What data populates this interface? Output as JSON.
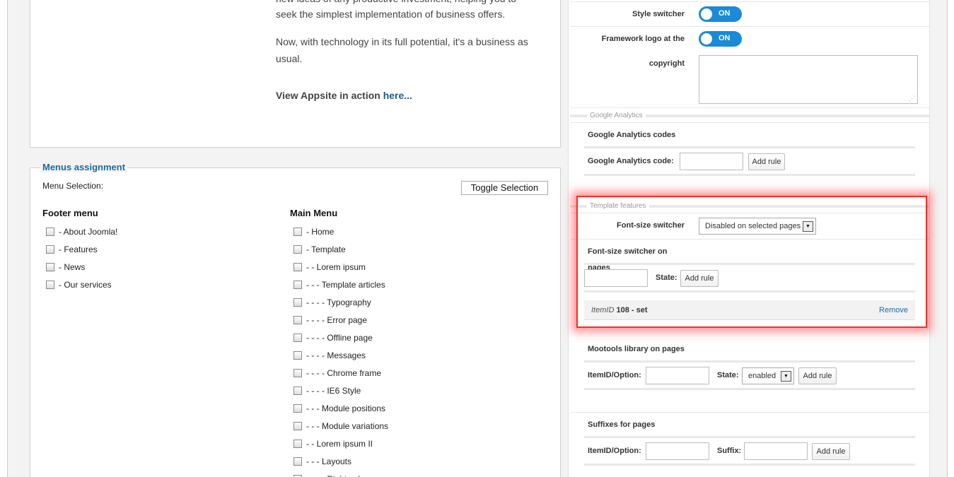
{
  "description": {
    "line_cut": "new ideas of any productive investment, helping you to",
    "line2": "seek the simplest implementation of business offers.",
    "para2": "Now, with technology in its full potential, it's a business as usual.",
    "view_text": "View Appsite in action ",
    "view_link": "here..."
  },
  "menus": {
    "legend": "Menus assignment",
    "selection_label": "Menu Selection:",
    "toggle_button": "Toggle Selection",
    "footer_title": "Footer menu",
    "footer_items": [
      "- About Joomla!",
      "- Features",
      "- News",
      "- Our services"
    ],
    "main_title": "Main Menu",
    "main_items": [
      "- Home",
      "- Template",
      "- - Lorem ipsum",
      "- - - Template articles",
      "- - - - Typography",
      "- - - - Error page",
      "- - - - Offline page",
      "- - - - Messages",
      "- - - - Chrome frame",
      "- - - - IE6 Style",
      "- - - Module positions",
      "- - - Module variations",
      "- - Lorem ipsum II",
      "- - - Layouts",
      "- - - - Right column"
    ]
  },
  "settings": {
    "style_switcher_label": "Style switcher",
    "style_switcher_value": "ON",
    "framework_logo_label": "Framework logo at the",
    "framework_logo_value": "ON",
    "copyright_label": "copyright",
    "analytics_legend": "Google Analytics",
    "analytics_codes_title": "Google Analytics codes",
    "analytics_code_label": "Google Analytics code:",
    "add_rule": "Add rule",
    "template_features_legend": "Template features",
    "font_switcher_label": "Font-size switcher",
    "font_switcher_value": "Disabled on selected pages",
    "font_switcher_on_title": "Font-size switcher on",
    "font_switcher_on_title2": "pages",
    "state_label": "State:",
    "rule_item_prefix": "ItemID",
    "rule_item_value": "108 - set",
    "remove_label": "Remove",
    "mootools_title": "Mootools library on pages",
    "itemid_option_label": "ItemID/Option:",
    "mootools_state_value": "enabled",
    "suffixes_title": "Suffixes for pages",
    "suffix_label": "Suffix:"
  },
  "colors": {
    "link": "#1e6a9f",
    "toggle_on": "#1a8ad9",
    "highlight": "#ff2a2a"
  }
}
